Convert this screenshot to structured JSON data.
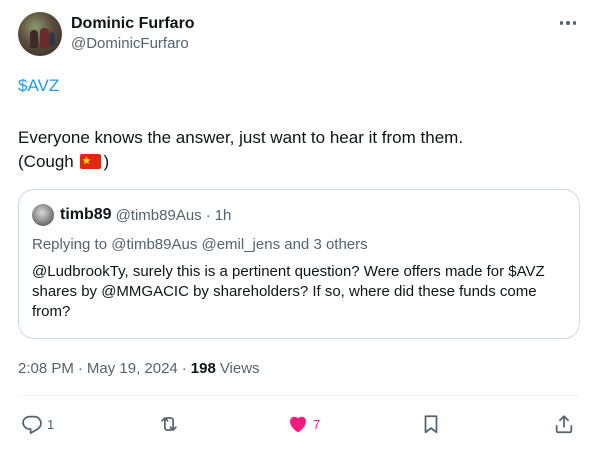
{
  "author": {
    "display_name": "Dominic Furfaro",
    "handle": "@DominicFurfaro"
  },
  "tweet": {
    "cashtag": "$AVZ",
    "text_main": "Everyone knows the answer, just want to hear it from them.",
    "text_cough_prefix": "(Cough ",
    "text_cough_suffix": ")"
  },
  "quote": {
    "name": "timb89",
    "handle": "@timb89Aus",
    "separator": "·",
    "time": "1h",
    "replying_to_label": "Replying to",
    "replying_to_users": "@timb89Aus @emil_jens",
    "replying_to_others": "and 3 others",
    "text": "@LudbrookTy, surely this is a pertinent question? Were offers made for $AVZ shares by @MMGACIC by shareholders? If so, where did these funds come from?"
  },
  "meta": {
    "time": "2:08 PM",
    "dot": "·",
    "date": "May 19, 2024",
    "views_count": "198",
    "views_label": "Views"
  },
  "actions": {
    "reply_count": "1",
    "repost_count": "",
    "like_count": "7"
  },
  "colors": {
    "accent": "#1d9bf0",
    "like": "#f91880",
    "secondary_text": "#536471",
    "border": "#cfd9de"
  }
}
